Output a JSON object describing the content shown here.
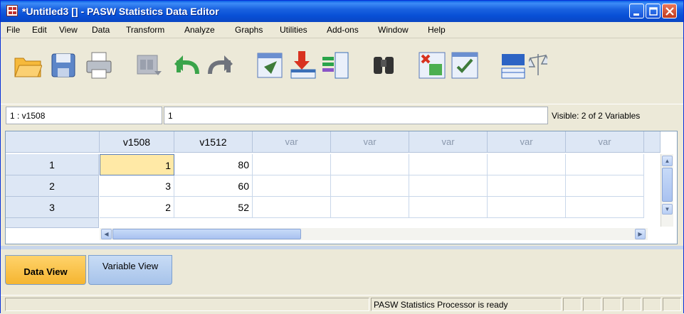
{
  "window": {
    "title": "*Untitled3 [] - PASW Statistics Data Editor",
    "colors": {
      "titlebar": "#0a5fe6",
      "close": "#d1492a"
    }
  },
  "menu": {
    "items": [
      {
        "label": "File"
      },
      {
        "label": "Edit"
      },
      {
        "label": "View"
      },
      {
        "label": "Data"
      },
      {
        "label": "Transform"
      },
      {
        "label": "Analyze"
      },
      {
        "label": "Graphs"
      },
      {
        "label": "Utilities"
      },
      {
        "label": "Add-ons"
      },
      {
        "label": "Window"
      },
      {
        "label": "Help"
      }
    ]
  },
  "toolbar": {
    "icons": [
      "open-folder-icon",
      "save-icon",
      "print-icon",
      "dialog-recall-icon",
      "undo-icon",
      "redo-icon",
      "go-to-case-icon",
      "insert-cases-icon",
      "insert-variable-icon",
      "find-icon",
      "split-file-icon",
      "select-cases-icon",
      "value-labels-icon",
      "weight-cases-icon"
    ]
  },
  "editbar": {
    "cell_ref": "1 : v1508",
    "cell_value": "1",
    "visible": "Visible: 2 of 2 Variables"
  },
  "grid": {
    "columns": [
      "v1508",
      "v1512",
      "var",
      "var",
      "var",
      "var",
      "var"
    ],
    "rows": [
      {
        "num": "1",
        "v1508": "1",
        "v1512": "80"
      },
      {
        "num": "2",
        "v1508": "3",
        "v1512": "60"
      },
      {
        "num": "3",
        "v1508": "2",
        "v1512": "52"
      }
    ],
    "selected_color": "#ffe9a6"
  },
  "tabs": {
    "data_view": "Data View",
    "variable_view": "Variable View"
  },
  "status": {
    "text": "PASW Statistics Processor is ready"
  }
}
